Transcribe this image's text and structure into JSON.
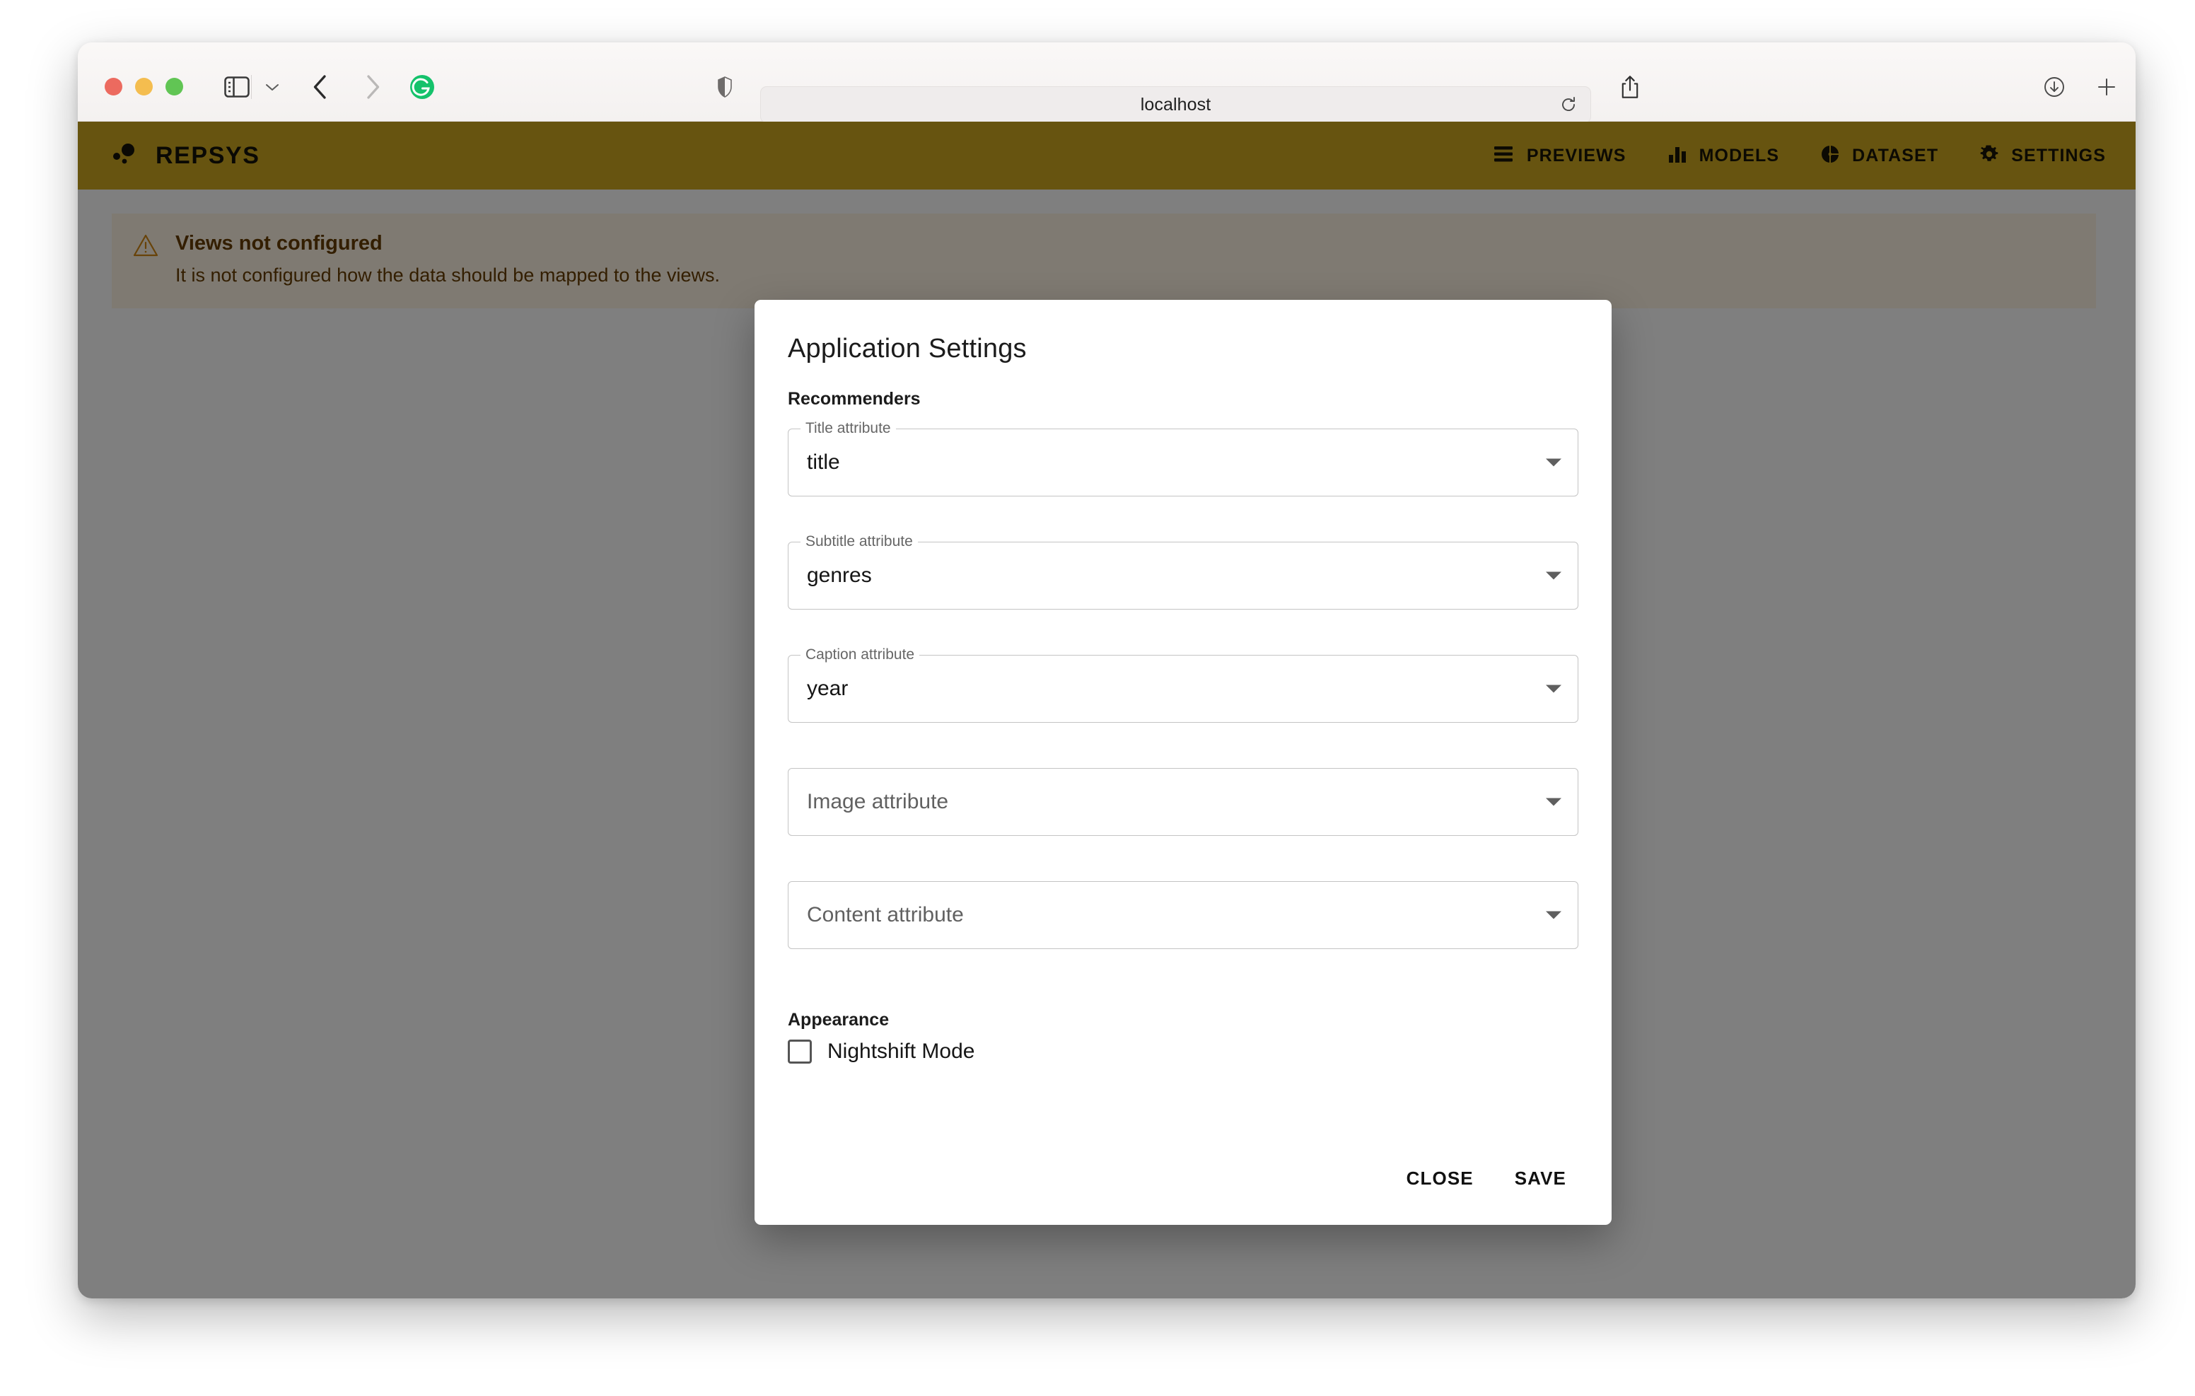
{
  "browser": {
    "url": "localhost",
    "traffic_lights": [
      "close",
      "minimize",
      "zoom"
    ],
    "toolbar_icons": [
      "sidebar-toggle-icon",
      "chevron-down-icon",
      "back-arrow-icon",
      "forward-arrow-icon",
      "grammarly-icon",
      "shield-icon",
      "reload-icon",
      "share-icon",
      "downloads-icon",
      "new-tab-icon",
      "tab-overview-icon"
    ]
  },
  "app_bar": {
    "brand_title": "REPSYS",
    "brand_icon": "bubble-dots-icon",
    "background_color": "#cfa921",
    "nav": [
      {
        "label": "PREVIEWS",
        "icon": "list-icon"
      },
      {
        "label": "MODELS",
        "icon": "bar-chart-icon"
      },
      {
        "label": "DATASET",
        "icon": "pie-chart-icon"
      },
      {
        "label": "SETTINGS",
        "icon": "gear-icon"
      }
    ]
  },
  "alert": {
    "icon": "warning-triangle-icon",
    "title": "Views not configured",
    "body": "It is not configured how the data should be mapped to the views.",
    "background_color": "#fff4e5",
    "text_color": "#663c00"
  },
  "dialog": {
    "title": "Application Settings",
    "sections": {
      "recommenders": "Recommenders",
      "appearance": "Appearance"
    },
    "fields": [
      {
        "label": "Title attribute",
        "value": "title",
        "has_value": true
      },
      {
        "label": "Subtitle attribute",
        "value": "genres",
        "has_value": true
      },
      {
        "label": "Caption attribute",
        "value": "year",
        "has_value": true
      },
      {
        "label": "Image attribute",
        "value": "",
        "placeholder": "Image attribute",
        "has_value": false
      },
      {
        "label": "Content attribute",
        "value": "",
        "placeholder": "Content attribute",
        "has_value": false
      }
    ],
    "checkbox": {
      "label": "Nightshift Mode",
      "checked": false
    },
    "actions": {
      "close": "CLOSE",
      "save": "SAVE"
    }
  }
}
